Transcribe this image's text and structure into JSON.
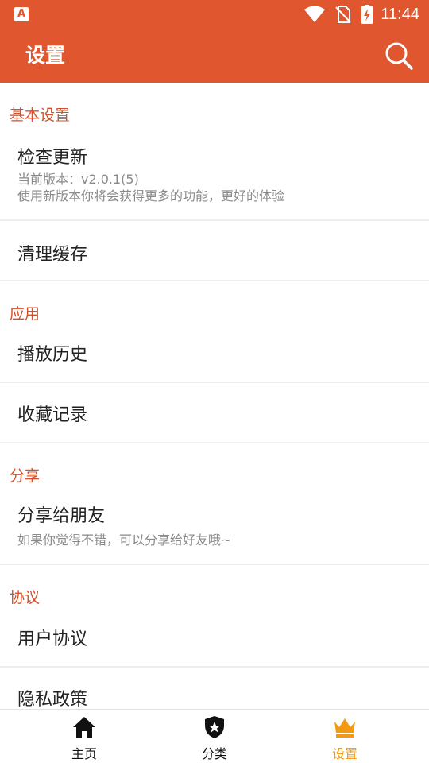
{
  "status_bar": {
    "left_icon": "app-notification-icon",
    "left_icon_text": "A",
    "time": "11:44",
    "icons": [
      "wifi-icon",
      "no-sim-icon",
      "battery-charging-icon"
    ]
  },
  "app_bar": {
    "title": "设置",
    "search_icon": "search-icon"
  },
  "sections": {
    "basic": {
      "header": "基本设置",
      "check_update": {
        "title": "检查更新",
        "version": "当前版本：v2.0.1(5)",
        "desc": "使用新版本你将会获得更多的功能，更好的体验"
      },
      "clear_cache": {
        "title": "清理缓存"
      }
    },
    "app": {
      "header": "应用",
      "history": {
        "title": "播放历史"
      },
      "favorites": {
        "title": "收藏记录"
      }
    },
    "share": {
      "header": "分享",
      "share_friends": {
        "title": "分享给朋友",
        "desc": "如果你觉得不错，可以分享给好友哦~"
      }
    },
    "agreement": {
      "header": "协议",
      "user_agreement": {
        "title": "用户协议"
      },
      "privacy_policy": {
        "title": "隐私政策"
      }
    }
  },
  "bottom_nav": {
    "items": [
      {
        "label": "主页",
        "icon": "home-icon",
        "active": false
      },
      {
        "label": "分类",
        "icon": "shield-star-icon",
        "active": false
      },
      {
        "label": "设置",
        "icon": "crown-icon",
        "active": true
      }
    ]
  },
  "colors": {
    "primary": "#e0562e",
    "section_header": "#d4512b",
    "active_tab": "#f29a13"
  }
}
